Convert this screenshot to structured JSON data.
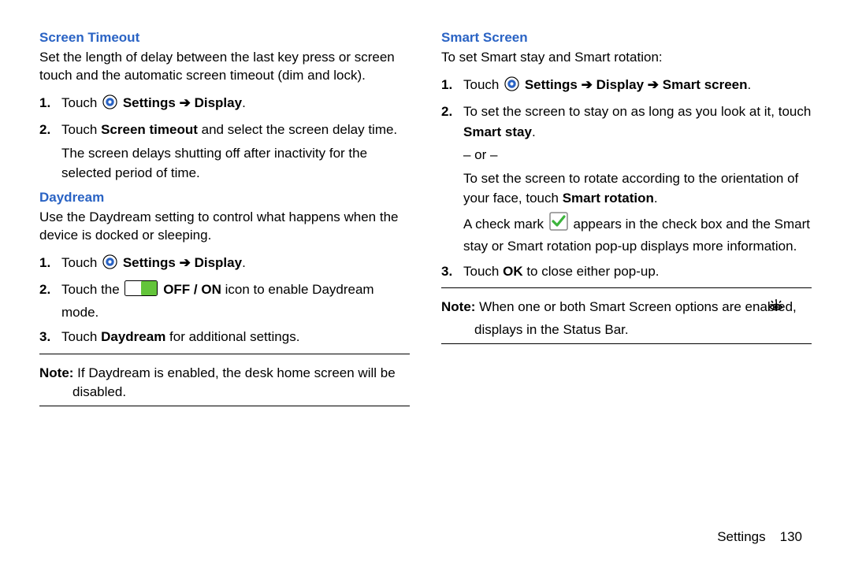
{
  "left": {
    "screen_timeout": {
      "heading": "Screen Timeout",
      "intro": "Set the length of delay between the last key press or screen touch and the automatic screen timeout (dim and lock).",
      "steps": [
        {
          "touch_prefix": "Touch ",
          "path_a": "Settings",
          "arrow": " ➔ ",
          "path_b": "Display",
          "suffix": "."
        },
        {
          "line1_a": "Touch ",
          "line1_b": "Screen timeout",
          "line1_c": " and select the screen delay time.",
          "line2": "The screen delays shutting off after inactivity for the selected period of time."
        }
      ]
    },
    "daydream": {
      "heading": "Daydream",
      "intro": "Use the Daydream setting to control what happens when the device is docked or sleeping.",
      "steps": [
        {
          "touch_prefix": "Touch ",
          "path_a": "Settings",
          "arrow": " ➔ ",
          "path_b": "Display",
          "suffix": "."
        },
        {
          "a": "Touch the ",
          "off_on": "OFF / ON",
          "b": " icon to enable Daydream mode."
        },
        {
          "a": "Touch ",
          "bold": "Daydream",
          "b": " for additional settings."
        }
      ],
      "note_label": "Note:",
      "note_body": " If Daydream is enabled, the desk home screen will be disabled."
    }
  },
  "right": {
    "smart_screen": {
      "heading": "Smart Screen",
      "intro": "To set Smart stay and Smart rotation:",
      "step1": {
        "touch_prefix": "Touch ",
        "path_a": "Settings",
        "arrow1": " ➔ ",
        "path_b": "Display",
        "arrow2": " ➔ ",
        "path_c": "Smart screen",
        "suffix": "."
      },
      "step2": {
        "a": "To set the screen to stay on as long as you look at it, touch ",
        "stay": "Smart stay",
        "period": ".",
        "or": "– or –",
        "b1": "To set the screen to rotate according to the orientation of your face, touch ",
        "rot": "Smart rotation",
        "b1p": ".",
        "c1": "A check mark ",
        "c2": " appears in the check box and the Smart stay or Smart rotation pop-up displays more information."
      },
      "step3": {
        "a": "Touch ",
        "ok": "OK",
        "b": " to close either pop-up."
      },
      "note_label": "Note:",
      "note_body1": " When one or both Smart Screen options are enabled, ",
      "note_body2": " displays in the Status Bar."
    }
  },
  "footer": {
    "section": "Settings",
    "page": "130"
  }
}
